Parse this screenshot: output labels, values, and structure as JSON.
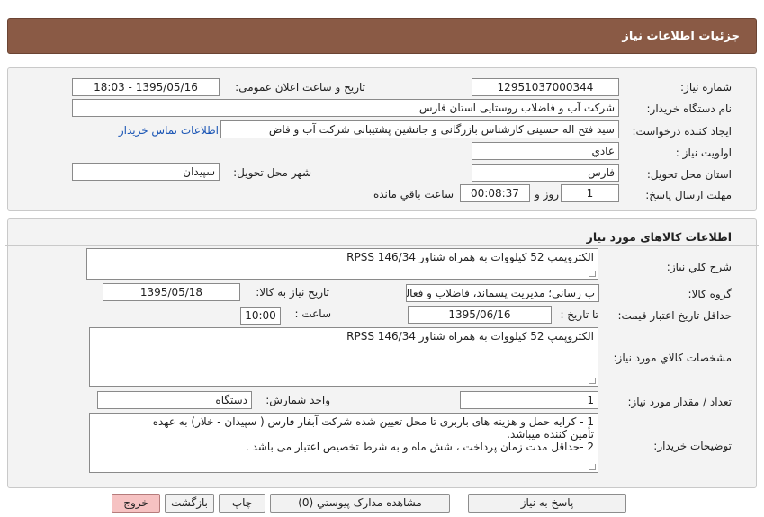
{
  "header": {
    "title": "جزئیات اطلاعات نیاز"
  },
  "info": {
    "need_number_label": "شماره نیاز:",
    "need_number": "12951037000344",
    "announce_label": "تاریخ و ساعت اعلان عمومی:",
    "announce_value": "1395/05/16 - 18:03",
    "buyer_org_label": "نام دستگاه خریدار:",
    "buyer_org": "شرکت آب و فاضلاب روستایی استان فارس",
    "creator_label": "ایجاد کننده درخواست:",
    "creator": "سید فتح اله  حسینی  کارشناس بازرگانی و جانشین پشتیبانی شرکت آب و فاض",
    "contact_link": "اطلاعات تماس خریدار",
    "priority_label": "اولویت نیاز :",
    "priority": "عادي",
    "province_label": "استان محل تحویل:",
    "province": "فارس",
    "city_label": "شهر محل تحویل:",
    "city": "سپیدان",
    "deadline_label": "مهلت ارسال پاسخ:",
    "deadline_days": "1",
    "day_label": "روز و",
    "deadline_time": "00:08:37",
    "remaining_label": "ساعت باقي مانده"
  },
  "goods": {
    "section_title": "اطلاعات کالاهای مورد نیاز",
    "general_desc_label": "شرح کلي نیاز:",
    "general_desc": "الکتروپمپ 52 کیلووات به همراه شناور RPSS 146/34",
    "group_label": "گروه کالا:",
    "group_value": "ب رسانی؛ مدیریت پسماند، فاضلاب و فعالیت های",
    "need_date_label": "تاریخ نیاز به کالا:",
    "need_date": "1395/05/18",
    "validity_label": "حداقل تاریخ اعتبار قیمت:",
    "until_date_label": "تا تاریخ :",
    "until_date": "1395/06/16",
    "hour_label": "ساعت :",
    "hour_value": "10:00",
    "specs_label": "مشخصات کالاي مورد نیاز:",
    "specs": "الکتروپمپ 52 کیلووات به همراه شناور RPSS 146/34",
    "qty_label": "تعداد / مقدار مورد نیاز:",
    "qty": "1",
    "unit_label": "واحد شمارش:",
    "unit": "دستگاه",
    "buyer_notes_label": "توضیحات خریدار:",
    "buyer_notes_line1": "1 - کرایه حمل و هزینه های باربری تا محل تعیین شده شرکت آبفار فارس ( سپیدان - خلار) به عهده",
    "buyer_notes_line2": "تأمین کننده میباشد.",
    "buyer_notes_line3": "2 -حداقل مدت زمان پرداخت ، شش ماه و به شرط تخصیص اعتبار می باشد ."
  },
  "buttons": {
    "reply": "پاسخ به نیاز",
    "attachments": "مشاهده مدارک پیوستي (0)",
    "print": "چاپ",
    "back": "بازگشت",
    "exit": "خروج"
  }
}
